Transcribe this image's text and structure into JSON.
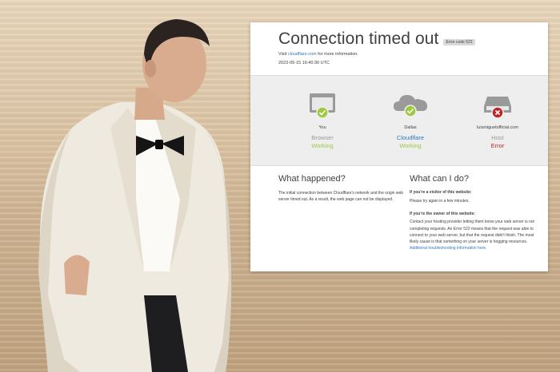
{
  "page": {
    "title": "Connection timed out",
    "error_code": "Error code 522",
    "visit_prefix": "Visit ",
    "visit_link": "cloudflare.com",
    "visit_suffix": " for more information.",
    "timestamp": "2023-05-15 16:40:30 UTC"
  },
  "nodes": [
    {
      "label": "You",
      "role": "Browser",
      "state": "Working",
      "icon": "browser-icon"
    },
    {
      "label": "Dallas",
      "role": "Cloudflare",
      "state": "Working",
      "icon": "cloud-icon"
    },
    {
      "label": "luismiguelofficial.com",
      "role": "Host",
      "state": "Error",
      "icon": "server-icon"
    }
  ],
  "what_happened": {
    "heading": "What happened?",
    "text": "The initial connection between Cloudflare's network and the origin web server timed out. As a result, the web page can not be displayed."
  },
  "what_can_i_do": {
    "heading": "What can I do?",
    "visitor_heading": "If you're a visitor of this website:",
    "visitor_text": "Please try again in a few minutes.",
    "owner_heading": "If you're the owner of this website:",
    "owner_text": "Contact your hosting provider letting them know your web server is not completing requests. An Error 522 means that the request was able to connect to your web server, but that the request didn't finish. The most likely cause is that something on your server is hogging resources.",
    "owner_link": "Additional troubleshooting information here."
  },
  "colors": {
    "working": "#9bca3e",
    "error": "#bd2426",
    "link": "#2f7bbf"
  }
}
